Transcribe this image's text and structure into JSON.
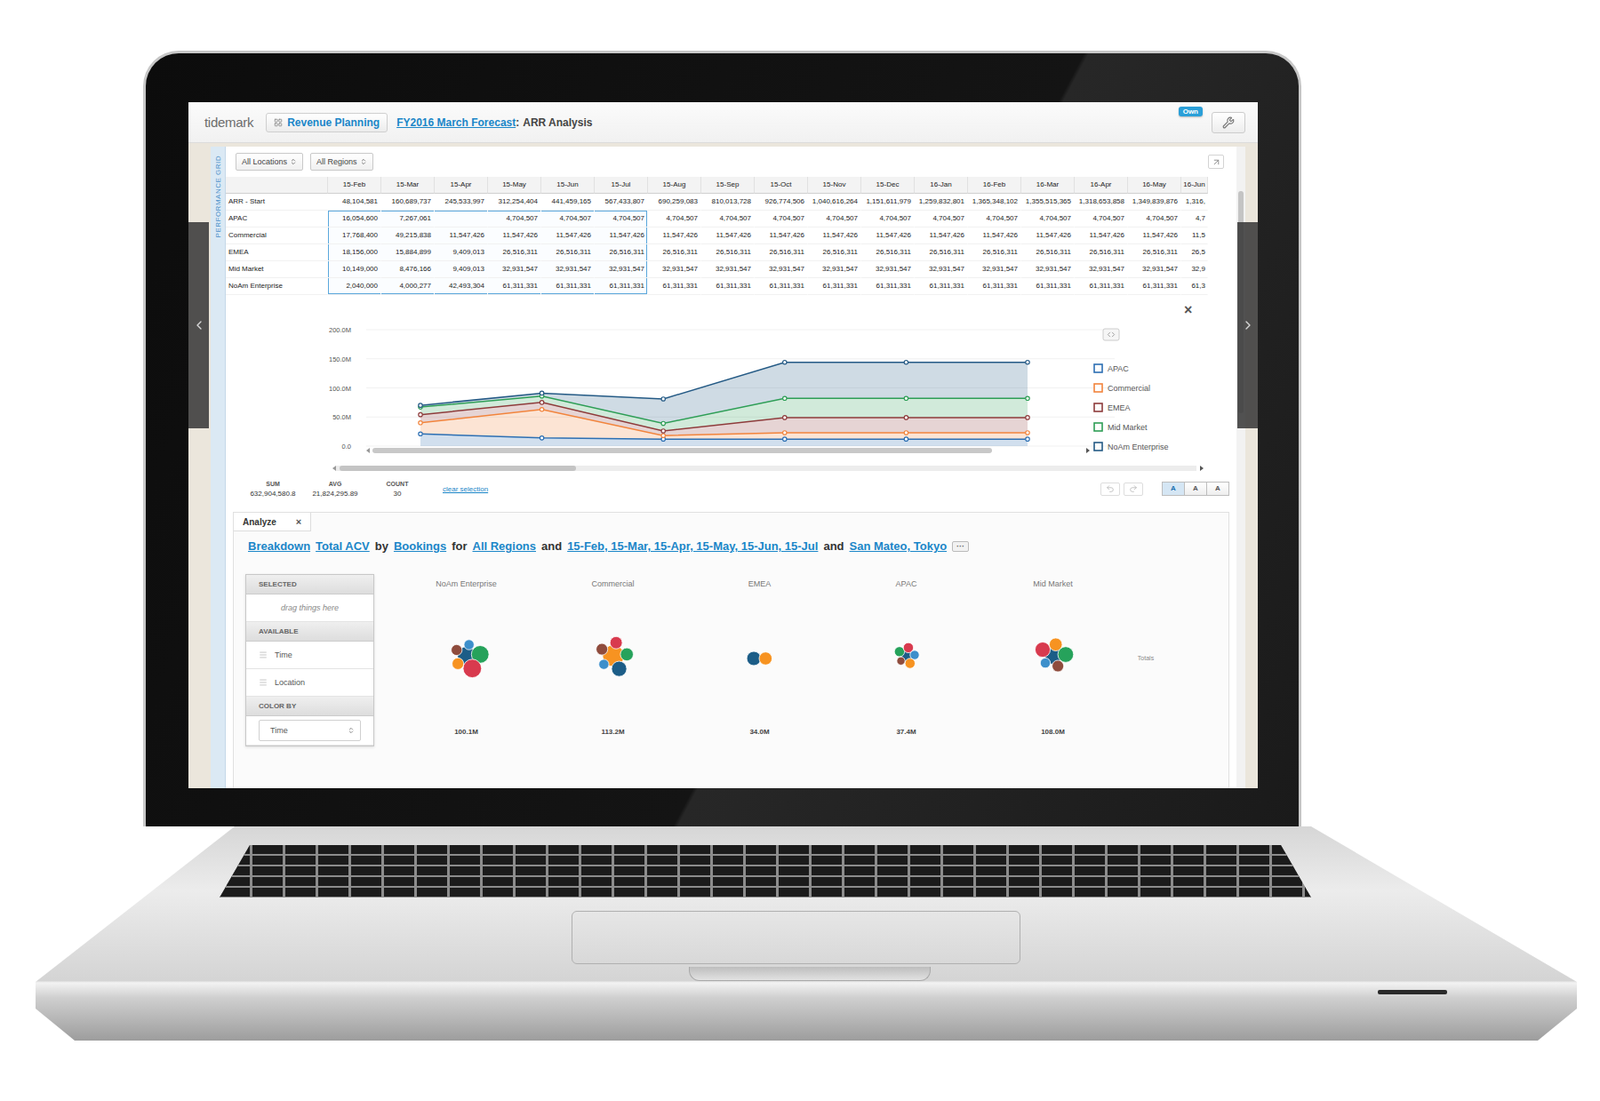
{
  "header": {
    "logo": "tidemark",
    "module": "Revenue Planning",
    "document": "FY2016 March Forecast",
    "separator": ":",
    "view": "ARR Analysis",
    "badge": "Own"
  },
  "side_label": "PERFORMANCE GRID",
  "filters": [
    {
      "label": "All Locations"
    },
    {
      "label": "All Regions"
    }
  ],
  "grid": {
    "columns": [
      {
        "label": "15-Feb",
        "selected": true
      },
      {
        "label": "15-Mar",
        "selected": true
      },
      {
        "label": "15-Apr",
        "selected": true
      },
      {
        "label": "15-May",
        "selected": true
      },
      {
        "label": "15-Jun",
        "selected": true
      },
      {
        "label": "15-Jul",
        "selected": true
      },
      {
        "label": "15-Aug",
        "selected": false
      },
      {
        "label": "15-Sep",
        "selected": false
      },
      {
        "label": "15-Oct",
        "selected": false
      },
      {
        "label": "15-Nov",
        "selected": false
      },
      {
        "label": "15-Dec",
        "selected": false
      },
      {
        "label": "16-Jan",
        "selected": false
      },
      {
        "label": "16-Feb",
        "selected": false
      },
      {
        "label": "16-Mar",
        "selected": false
      },
      {
        "label": "16-Apr",
        "selected": false
      },
      {
        "label": "16-May",
        "selected": false
      },
      {
        "label": "16-Jun",
        "selected": false
      }
    ],
    "rows": [
      {
        "label": "ARR - Start",
        "selected": false,
        "cells": [
          "48,104,581",
          "160,689,737",
          "245,533,997",
          "312,254,404",
          "441,459,165",
          "567,433,807",
          "690,259,083",
          "810,013,728",
          "926,774,506",
          "1,040,616,264",
          "1,151,611,979",
          "1,259,832,801",
          "1,365,348,102",
          "1,355,515,365",
          "1,318,653,858",
          "1,349,839,876",
          "1,316,"
        ]
      },
      {
        "label": "APAC",
        "selected": true,
        "cells": [
          "16,054,600",
          "7,267,061",
          "",
          "4,704,507",
          "4,704,507",
          "4,704,507",
          "4,704,507",
          "4,704,507",
          "4,704,507",
          "4,704,507",
          "4,704,507",
          "4,704,507",
          "4,704,507",
          "4,704,507",
          "4,704,507",
          "4,704,507",
          "4,7"
        ]
      },
      {
        "label": "Commercial",
        "selected": true,
        "cells": [
          "17,768,400",
          "49,215,838",
          "11,547,426",
          "11,547,426",
          "11,547,426",
          "11,547,426",
          "11,547,426",
          "11,547,426",
          "11,547,426",
          "11,547,426",
          "11,547,426",
          "11,547,426",
          "11,547,426",
          "11,547,426",
          "11,547,426",
          "11,547,426",
          "11,5"
        ]
      },
      {
        "label": "EMEA",
        "selected": true,
        "cells": [
          "18,156,000",
          "15,884,899",
          "9,409,013",
          "26,516,311",
          "26,516,311",
          "26,516,311",
          "26,516,311",
          "26,516,311",
          "26,516,311",
          "26,516,311",
          "26,516,311",
          "26,516,311",
          "26,516,311",
          "26,516,311",
          "26,516,311",
          "26,516,311",
          "26,5"
        ]
      },
      {
        "label": "Mid Market",
        "selected": true,
        "cells": [
          "10,149,000",
          "8,476,166",
          "9,409,013",
          "32,931,547",
          "32,931,547",
          "32,931,547",
          "32,931,547",
          "32,931,547",
          "32,931,547",
          "32,931,547",
          "32,931,547",
          "32,931,547",
          "32,931,547",
          "32,931,547",
          "32,931,547",
          "32,931,547",
          "32,9"
        ]
      },
      {
        "label": "NoAm Enterprise",
        "selected": true,
        "cells": [
          "2,040,000",
          "4,000,277",
          "42,493,304",
          "61,311,331",
          "61,311,331",
          "61,311,331",
          "61,311,331",
          "61,311,331",
          "61,311,331",
          "61,311,331",
          "61,311,331",
          "61,311,331",
          "61,311,331",
          "61,311,331",
          "61,311,331",
          "61,311,331",
          "61,3"
        ]
      }
    ]
  },
  "chart": {
    "y_ticks": [
      "200.0M",
      "150.0M",
      "100.0M",
      "50.0M",
      "0.0"
    ],
    "y_max": 200,
    "close": "×",
    "series": [
      {
        "name": "APAC",
        "color": "#2c6fb3",
        "values": [
          21,
          14,
          12,
          12,
          12,
          12
        ]
      },
      {
        "name": "Commercial",
        "color": "#f2843c",
        "values": [
          40,
          63,
          18,
          23,
          23,
          23
        ]
      },
      {
        "name": "EMEA",
        "color": "#8e3b3b",
        "values": [
          54,
          75,
          26,
          49,
          49,
          49
        ]
      },
      {
        "name": "Mid Market",
        "color": "#2e9e56",
        "values": [
          67,
          86,
          39,
          82,
          82,
          82
        ]
      },
      {
        "name": "NoAm Enterprise",
        "color": "#245a85",
        "values": [
          70,
          91,
          81,
          144,
          144,
          144
        ]
      }
    ]
  },
  "summary": {
    "stats": [
      {
        "label": "SUM",
        "value": "632,904,580.8"
      },
      {
        "label": "AVG",
        "value": "21,824,295.89"
      },
      {
        "label": "COUNT",
        "value": "30"
      }
    ],
    "clear": "clear selection",
    "text_sizes": [
      {
        "label": "A",
        "selected": true
      },
      {
        "label": "A",
        "selected": false
      },
      {
        "label": "A",
        "selected": false
      }
    ]
  },
  "analyze": {
    "tab": "Analyze",
    "close": "×",
    "query": [
      {
        "text": "Breakdown",
        "link": true
      },
      {
        "text": "Total ACV",
        "link": true
      },
      {
        "text": "by",
        "link": false
      },
      {
        "text": "Bookings",
        "link": true
      },
      {
        "text": "for",
        "link": false
      },
      {
        "text": "All Regions",
        "link": true
      },
      {
        "text": "and",
        "link": false
      },
      {
        "text": "15-Feb, 15-Mar, 15-Apr, 15-May, 15-Jun, 15-Jul",
        "link": true
      },
      {
        "text": "and",
        "link": false
      },
      {
        "text": "San Mateo, Tokyo",
        "link": true
      }
    ],
    "more": "···",
    "sections": [
      {
        "title": "SELECTED",
        "items": [
          {
            "label": "drag things here",
            "kind": "placeholder"
          }
        ]
      },
      {
        "title": "AVAILABLE",
        "items": [
          {
            "label": "Time",
            "kind": "field"
          },
          {
            "label": "Location",
            "kind": "field"
          }
        ]
      },
      {
        "title": "COLOR BY",
        "items": [
          {
            "label": "Time",
            "kind": "select"
          }
        ]
      }
    ],
    "groups": [
      {
        "name": "NoAm Enterprise",
        "total": "100.1M",
        "bubbles": [
          {
            "color": "#1c5d87",
            "value": 20
          },
          {
            "color": "#8f4c3d",
            "value": 6
          },
          {
            "color": "#3d8fcb",
            "value": 5
          },
          {
            "color": "#26a25b",
            "value": 18
          },
          {
            "color": "#d83a4e",
            "value": 20
          },
          {
            "color": "#f79321",
            "value": 7
          }
        ]
      },
      {
        "name": "Commercial",
        "total": "113.2M",
        "bubbles": [
          {
            "color": "#f79321",
            "value": 28
          },
          {
            "color": "#8f4c3d",
            "value": 7
          },
          {
            "color": "#d83a4e",
            "value": 8
          },
          {
            "color": "#26a25b",
            "value": 9
          },
          {
            "color": "#1c5d87",
            "value": 13
          },
          {
            "color": "#3d8fcb",
            "value": 5
          }
        ]
      },
      {
        "name": "EMEA",
        "total": "34.0M",
        "bubbles": [
          {
            "color": "#1c5d87",
            "value": 11
          },
          {
            "color": "#f79321",
            "value": 9
          }
        ]
      },
      {
        "name": "APAC",
        "total": "37.4M",
        "bubbles": [
          {
            "color": "#1c5d87",
            "value": 7
          },
          {
            "color": "#26a25b",
            "value": 5
          },
          {
            "color": "#d83a4e",
            "value": 5
          },
          {
            "color": "#3d8fcb",
            "value": 4
          },
          {
            "color": "#f79321",
            "value": 5
          },
          {
            "color": "#8f4c3d",
            "value": 3
          }
        ]
      },
      {
        "name": "Mid Market",
        "total": "108.0M",
        "bubbles": [
          {
            "color": "#1c5d87",
            "value": 17
          },
          {
            "color": "#d83a4e",
            "value": 13
          },
          {
            "color": "#f79321",
            "value": 9
          },
          {
            "color": "#26a25b",
            "value": 14
          },
          {
            "color": "#8f4c3d",
            "value": 7
          },
          {
            "color": "#3d8fcb",
            "value": 5
          }
        ]
      }
    ],
    "totals": "Totals"
  }
}
